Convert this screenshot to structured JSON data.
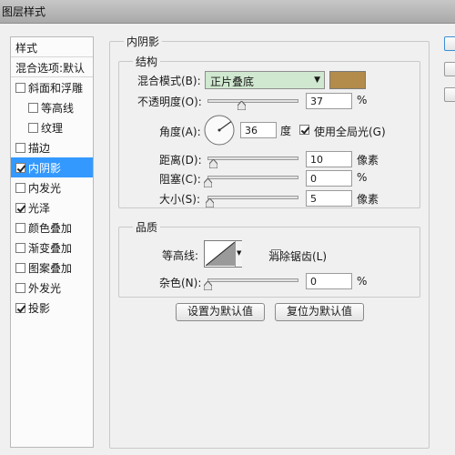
{
  "window": {
    "title": "图层样式"
  },
  "style_list": {
    "header": "样式",
    "blend_options": "混合选项:默认",
    "items": [
      {
        "label": "斜面和浮雕",
        "checked": false
      },
      {
        "label": "等高线",
        "checked": false
      },
      {
        "label": "纹理",
        "checked": false
      },
      {
        "label": "描边",
        "checked": false
      },
      {
        "label": "内阴影",
        "checked": true
      },
      {
        "label": "内发光",
        "checked": false
      },
      {
        "label": "光泽",
        "checked": true
      },
      {
        "label": "颜色叠加",
        "checked": false
      },
      {
        "label": "渐变叠加",
        "checked": false
      },
      {
        "label": "图案叠加",
        "checked": false
      },
      {
        "label": "外发光",
        "checked": false
      },
      {
        "label": "投影",
        "checked": true
      }
    ]
  },
  "inner_shadow": {
    "title": "内阴影",
    "structure": {
      "title": "结构",
      "blend_mode_label": "混合模式(B):",
      "blend_mode_value": "正片叠底",
      "color": "#b38b4a",
      "opacity_label": "不透明度(O):",
      "opacity_value": "37",
      "opacity_unit": "%",
      "opacity_level": 0.37,
      "angle_label": "角度(A):",
      "angle_value": "36",
      "angle_unit": "度",
      "global_light_label": "使用全局光(G)",
      "global_light_checked": true,
      "distance_label": "距离(D):",
      "distance_value": "10",
      "distance_unit": "像素",
      "choke_label": "阻塞(C):",
      "choke_value": "0",
      "choke_unit": "%",
      "size_label": "大小(S):",
      "size_value": "5",
      "size_unit": "像素"
    },
    "quality": {
      "title": "品质",
      "contour_label": "等高线:",
      "antialias_label": "消除锯齿(L)",
      "antialias_checked": false,
      "noise_label": "杂色(N):",
      "noise_value": "0",
      "noise_unit": "%"
    },
    "buttons": {
      "make_default": "设置为默认值",
      "reset_default": "复位为默认值"
    }
  },
  "colors": {
    "selection": "#3399ff",
    "blend_mode_bg": "#cfe8cf"
  }
}
